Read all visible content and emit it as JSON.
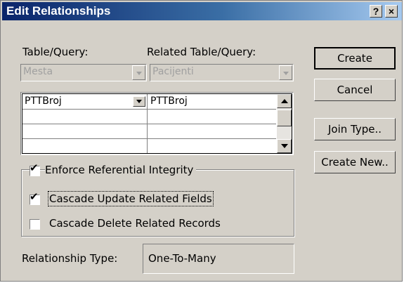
{
  "window": {
    "title": "Edit Relationships",
    "help_glyph": "?",
    "close_glyph": "×"
  },
  "labels": {
    "table_query": "Table/Query:",
    "related_table_query": "Related Table/Query:"
  },
  "combos": {
    "table": "Mesta",
    "related_table": "Pacijenti"
  },
  "grid": {
    "rows": [
      {
        "field": "PTTBroj",
        "related_field": "PTTBroj"
      },
      {
        "field": "",
        "related_field": ""
      },
      {
        "field": "",
        "related_field": ""
      },
      {
        "field": "",
        "related_field": ""
      }
    ]
  },
  "options": {
    "enforce_integrity": {
      "label": "Enforce Referential Integrity",
      "checked": true
    },
    "cascade_update": {
      "label": "Cascade Update Related Fields",
      "checked": true
    },
    "cascade_delete": {
      "label": "Cascade Delete Related Records",
      "checked": false
    }
  },
  "relationship": {
    "label": "Relationship Type:",
    "value": "One-To-Many"
  },
  "buttons": {
    "create": "Create",
    "cancel": "Cancel",
    "join_type": "Join Type..",
    "create_new": "Create New.."
  },
  "icons": [
    "help-icon",
    "close-icon",
    "dropdown-arrow-icon",
    "scroll-up-icon",
    "scroll-down-icon",
    "checkmark-icon"
  ],
  "colors": {
    "titlebar_start": "#0a246a",
    "titlebar_end": "#a6caf0",
    "face": "#d4d0c8"
  }
}
